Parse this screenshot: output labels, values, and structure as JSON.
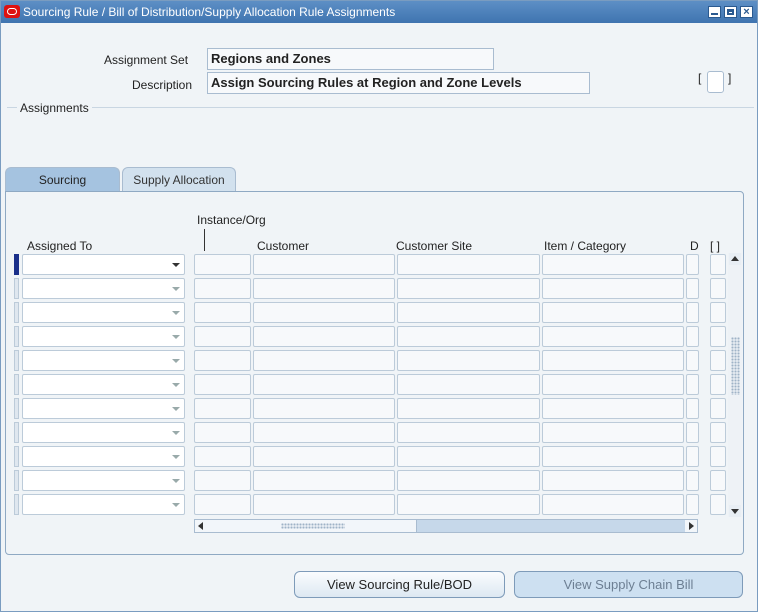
{
  "window": {
    "title": "Sourcing Rule / Bill of Distribution/Supply Allocation Rule Assignments"
  },
  "header": {
    "assignment_set_label": "Assignment Set",
    "assignment_set_value": "Regions and Zones",
    "description_label": "Description",
    "description_value": "Assign Sourcing Rules at Region and Zone Levels",
    "bracket_open": "[",
    "bracket_close": "]"
  },
  "section": {
    "title": "Assignments"
  },
  "tabs": [
    {
      "label": "Sourcing",
      "active": true
    },
    {
      "label": "Supply Allocation",
      "active": false
    }
  ],
  "table": {
    "group_header": "Instance/Org",
    "columns": [
      "Assigned To",
      "Customer",
      "Customer Site",
      "Item / Category",
      "D",
      "[ ]"
    ],
    "row_count": 11,
    "rows": []
  },
  "buttons": {
    "view_sourcing": "View Sourcing Rule/BOD",
    "view_supply_chain": "View Supply Chain Bill"
  },
  "icons": [
    "oracle-app-icon",
    "minimize-icon",
    "maximize-icon",
    "close-icon",
    "chevron-down-icon",
    "scroll-up-icon",
    "scroll-down-icon",
    "scroll-left-icon",
    "scroll-right-icon"
  ]
}
